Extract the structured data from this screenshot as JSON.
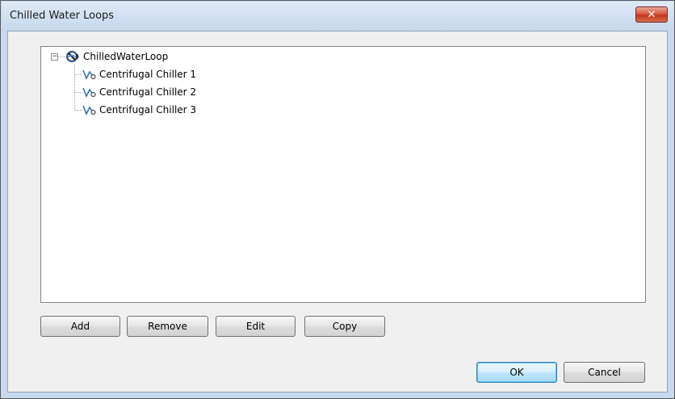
{
  "window": {
    "title": "Chilled Water Loops",
    "close_label": "✕"
  },
  "tree": {
    "root": {
      "label": "ChilledWaterLoop",
      "expander": "−",
      "icon": "water-loop-icon"
    },
    "children": [
      {
        "label": "Centrifugal Chiller 1",
        "icon": "chiller-icon"
      },
      {
        "label": "Centrifugal Chiller 2",
        "icon": "chiller-icon"
      },
      {
        "label": "Centrifugal Chiller 3",
        "icon": "chiller-icon"
      }
    ]
  },
  "actions": {
    "add": "Add",
    "remove": "Remove",
    "edit": "Edit",
    "copy": "Copy"
  },
  "footer": {
    "ok": "OK",
    "cancel": "Cancel"
  }
}
